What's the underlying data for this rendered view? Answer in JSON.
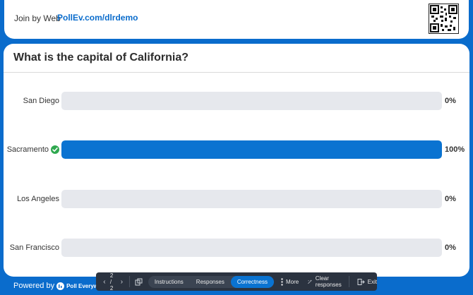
{
  "header": {
    "join_label": "Join by Web",
    "join_url": "PollEv.com/dlrdemo",
    "qr_icon": "qr-code-icon"
  },
  "poll": {
    "question": "What is the capital of California?",
    "options": [
      {
        "label": "San Diego",
        "percent_label": "0%",
        "value": 0,
        "correct": false
      },
      {
        "label": "Sacramento",
        "percent_label": "100%",
        "value": 100,
        "correct": true
      },
      {
        "label": "Los Angeles",
        "percent_label": "0%",
        "value": 0,
        "correct": false
      },
      {
        "label": "San Francisco",
        "percent_label": "0%",
        "value": 0,
        "correct": false
      }
    ]
  },
  "colors": {
    "background": "#0a6ccc",
    "bar_fill": "#0a73d1",
    "bar_track": "#e6e8ed",
    "correct": "#2fa84f",
    "toolbar": "#2b3340"
  },
  "footer": {
    "powered_by": "Powered by",
    "brand": "Poll Everywhere"
  },
  "toolbar": {
    "page": "2 / 2",
    "tabs": [
      "Instructions",
      "Responses",
      "Correctness"
    ],
    "active_tab": "Correctness",
    "more_label": "More",
    "clear_label": "Clear responses",
    "exit_label": "Exit"
  }
}
